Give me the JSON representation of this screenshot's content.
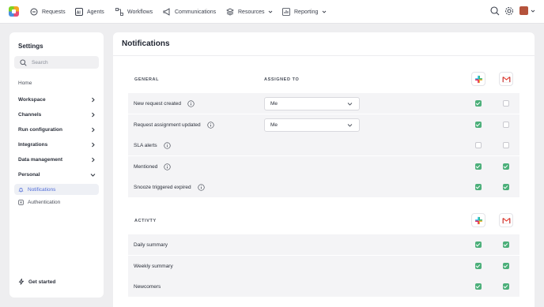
{
  "nav": {
    "items": [
      {
        "label": "Requests",
        "icon": "requests-icon"
      },
      {
        "label": "Agents",
        "icon": "ai-icon"
      },
      {
        "label": "Workflows",
        "icon": "workflows-icon"
      },
      {
        "label": "Communications",
        "icon": "megaphone-icon"
      },
      {
        "label": "Resources",
        "icon": "layers-icon"
      },
      {
        "label": "Reporting",
        "icon": "chart-icon"
      }
    ]
  },
  "sidebar": {
    "title": "Settings",
    "search_placeholder": "Search",
    "home": "Home",
    "sections": [
      {
        "label": "Workspace",
        "expanded": false
      },
      {
        "label": "Channels",
        "expanded": false
      },
      {
        "label": "Run configuration",
        "expanded": false
      },
      {
        "label": "Integrations",
        "expanded": false
      },
      {
        "label": "Data management",
        "expanded": false
      },
      {
        "label": "Personal",
        "expanded": true
      }
    ],
    "sub_items": [
      {
        "label": "Notifications",
        "active": true
      },
      {
        "label": "Authentication",
        "active": false
      }
    ],
    "get_started": "Get started"
  },
  "main": {
    "title": "Notifications",
    "general": {
      "heading": "GENERAL",
      "assigned_heading": "ASSIGNED TO",
      "rows": [
        {
          "label": "New request created",
          "assigned": "Me",
          "slack": true,
          "gmail": false
        },
        {
          "label": "Request assignment updated",
          "assigned": "Me",
          "slack": true,
          "gmail": false
        },
        {
          "label": "SLA alerts",
          "assigned": null,
          "slack": false,
          "gmail": false
        },
        {
          "label": "Mentioned",
          "assigned": null,
          "slack": true,
          "gmail": true
        },
        {
          "label": "Snooze triggered expired",
          "assigned": null,
          "slack": true,
          "gmail": true
        }
      ]
    },
    "activity": {
      "heading": "ACTIVTY",
      "rows": [
        {
          "label": "Daily summary",
          "slack": true,
          "gmail": true
        },
        {
          "label": "Weekly summary",
          "slack": true,
          "gmail": true
        },
        {
          "label": "Newcomers",
          "slack": true,
          "gmail": true
        }
      ]
    }
  },
  "colors": {
    "accent": "#4f6bd8",
    "checkbox_on": "#4caf7a",
    "row_bg": "#f4f4f6"
  }
}
